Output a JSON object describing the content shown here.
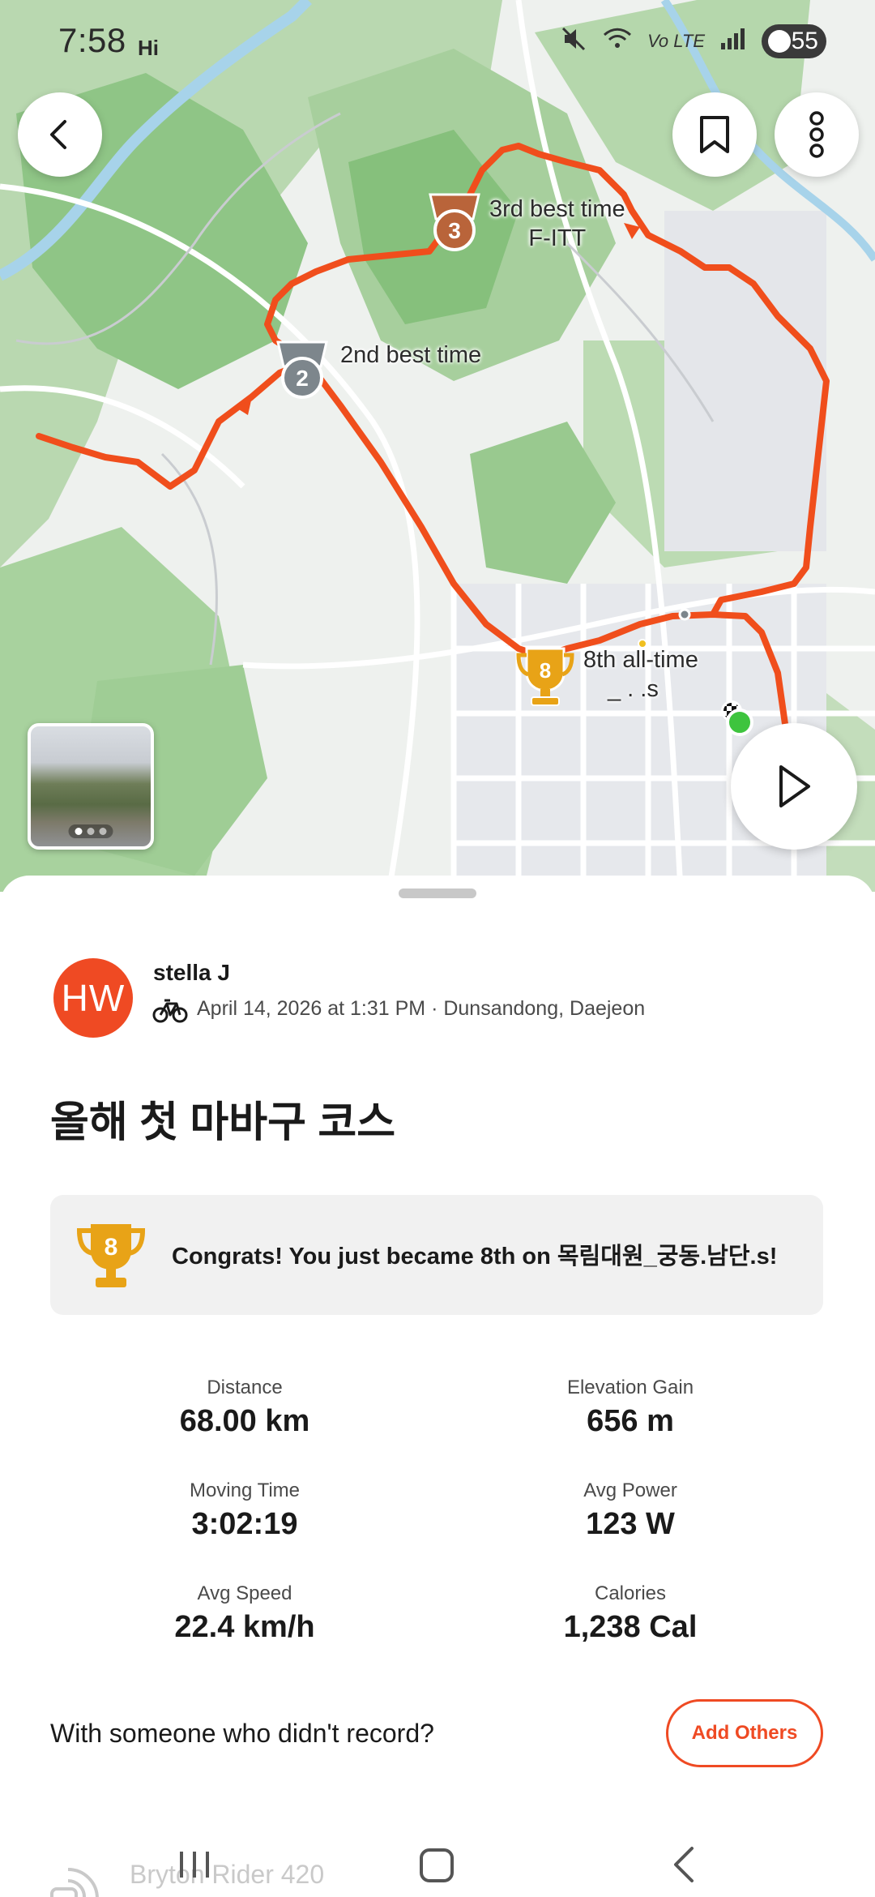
{
  "status_bar": {
    "time": "7:58",
    "indicator": "Hi",
    "network": "Vo LTE",
    "battery": "55"
  },
  "map": {
    "labels": {
      "third_best_line1": "3rd best time",
      "third_best_line2": "F-ITT",
      "second_best": "2nd best time",
      "eighth_all_time_line1": "8th all-time",
      "eighth_all_time_line2": "_ . .s"
    },
    "medals": {
      "third_rank": "3",
      "second_rank": "2",
      "eighth_rank": "8"
    },
    "route_color": "#f04e1c"
  },
  "activity": {
    "avatar_initials": "HW",
    "athlete_name": "stella J",
    "meta": "April 14, 2026 at 1:31 PM · Dunsandong, Daejeon",
    "title": "올해 첫 마바구 코스"
  },
  "achievement": {
    "rank": "8",
    "text": "Congrats! You just became 8th on 목림대원_궁동.남단.s!"
  },
  "stats": {
    "distance": {
      "label": "Distance",
      "value": "68.00 km"
    },
    "elevation": {
      "label": "Elevation Gain",
      "value": "656 m"
    },
    "moving_time": {
      "label": "Moving Time",
      "value": "3:02:19"
    },
    "avg_power": {
      "label": "Avg Power",
      "value": "123 W"
    },
    "avg_speed": {
      "label": "Avg Speed",
      "value": "22.4 km/h"
    },
    "calories": {
      "label": "Calories",
      "value": "1,238 Cal"
    }
  },
  "others": {
    "prompt": "With someone who didn't record?",
    "button": "Add Others"
  },
  "device": {
    "name": "Bryton Rider 420"
  },
  "colors": {
    "accent": "#ef4a23",
    "gold": "#e8a317",
    "bronze": "#b9643a",
    "silver": "#7d868c"
  }
}
